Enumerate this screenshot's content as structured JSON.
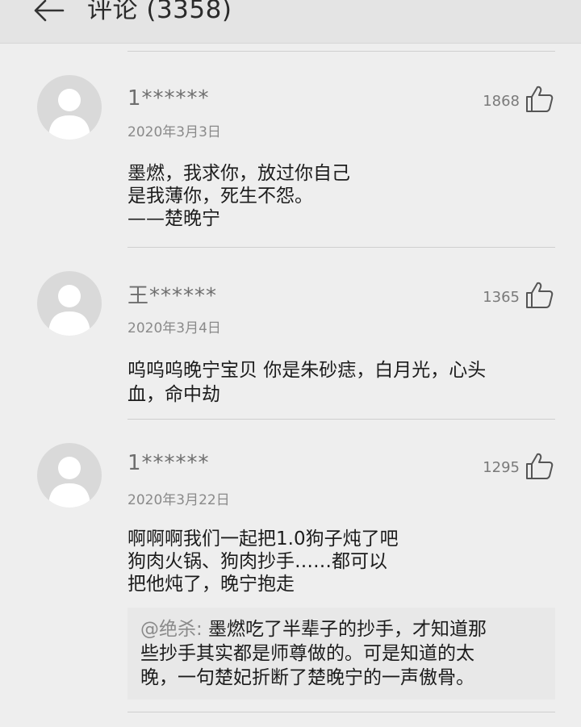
{
  "header": {
    "title": "评论 (3358)"
  },
  "comments": [
    {
      "username": "1******",
      "date": "2020年3月3日",
      "likes": "1868",
      "lines": [
        "墨燃，我求你，放过你自己",
        "是我薄你，死生不怨。",
        "——楚晚宁"
      ]
    },
    {
      "username": "王******",
      "date": "2020年3月4日",
      "likes": "1365",
      "lines": [
        "呜呜呜晚宁宝贝  你是朱砂痣，白月光，心头",
        "血，命中劫"
      ]
    },
    {
      "username": "1******",
      "date": "2020年3月22日",
      "likes": "1295",
      "lines": [
        "啊啊啊我们一起把1.0狗子炖了吧",
        "狗肉火锅、狗肉抄手……都可以",
        "把他炖了，晚宁抱走"
      ],
      "reply": {
        "user": "@绝杀:",
        "lines": [
          " 墨燃吃了半辈子的抄手，才知道那",
          "些抄手其实都是师尊做的。可是知道的太",
          "晚，一句楚妃折断了楚晚宁的一声傲骨。"
        ]
      }
    }
  ]
}
